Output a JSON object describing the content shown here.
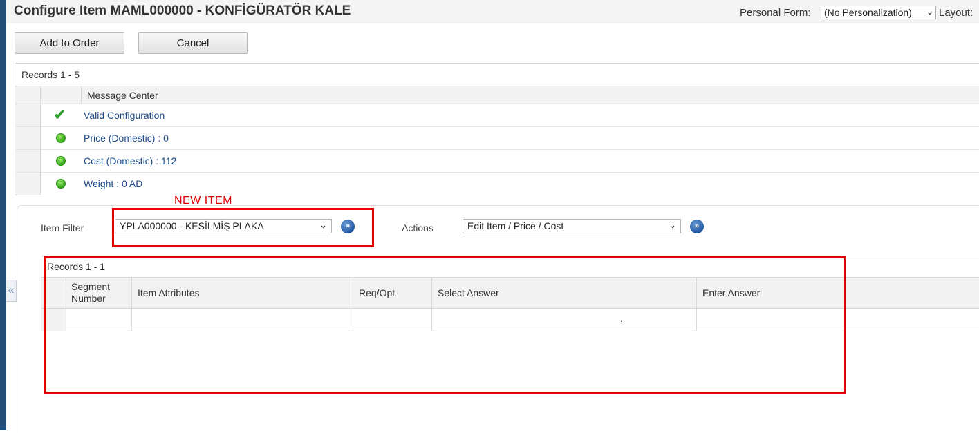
{
  "window": {
    "title": "Configure Item MAML000000 - KONFİGÜRATÖR KALE",
    "personal_form_label": "Personal Form:",
    "personal_form_value": "(No Personalization)",
    "layout_label": "Layout:"
  },
  "toolbar": {
    "add_to_order_label": "Add to Order",
    "cancel_label": "Cancel"
  },
  "message_center": {
    "records_label": "Records 1 - 5",
    "column_title": "Message Center",
    "rows": [
      {
        "icon": "check-icon",
        "text": "Valid Configuration"
      },
      {
        "icon": "green-dot-icon",
        "text": "Price (Domestic) : 0"
      },
      {
        "icon": "green-dot-icon",
        "text": "Cost (Domestic) : 112"
      },
      {
        "icon": "green-dot-icon",
        "text": "Weight : 0 AD"
      }
    ]
  },
  "annotation": {
    "new_item_label": "NEW ITEM",
    "color": "#e30000"
  },
  "filters": {
    "item_filter_label": "Item Filter",
    "item_filter_value": "YPLA000000 - KESİLMİŞ PLAKA",
    "actions_label": "Actions",
    "actions_value": "Edit Item / Price / Cost"
  },
  "attributes_grid": {
    "records_label": "Records 1 - 1",
    "columns": [
      "Segment Number",
      "Item Attributes",
      "Req/Opt",
      "Select Answer",
      "Enter Answer"
    ],
    "row_select_answer": "."
  }
}
